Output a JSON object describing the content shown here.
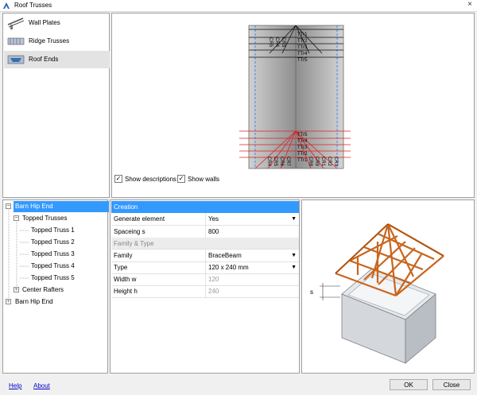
{
  "window": {
    "title": "Roof Trusses",
    "close_glyph": "×"
  },
  "nav": {
    "items": [
      {
        "label": "Wall Plates",
        "icon": "wall-plate-icon"
      },
      {
        "label": "Ridge Trusses",
        "icon": "ridge-truss-icon"
      },
      {
        "label": "Roof Ends",
        "icon": "roof-end-icon",
        "selected": true
      }
    ]
  },
  "preview": {
    "show_descriptions_label": "Show descriptions",
    "show_walls_label": "Show walls",
    "show_descriptions": true,
    "show_walls": true,
    "top_labels": [
      "TTr1",
      "TTr2",
      "TTr3",
      "TTr4",
      "TTr5"
    ],
    "bottom_labels": [
      "TTr5",
      "TTr4",
      "TTr3",
      "TTr2",
      "TTr1"
    ],
    "left_labels_top": [
      "CR5",
      "CR4",
      "CR3"
    ],
    "bottom_rafter_labels": [
      "CR4",
      "CR5",
      "CR6",
      "CR7",
      "CR8",
      "CR9",
      "CR1",
      "CR2",
      "CR3"
    ]
  },
  "tree": {
    "rows": [
      {
        "label": "Barn Hip End",
        "level": 0,
        "expander": "−",
        "selected": true
      },
      {
        "label": "Topped Trusses",
        "level": 1,
        "expander": "−"
      },
      {
        "label": "Topped Truss 1",
        "level": 2
      },
      {
        "label": "Topped Truss 2",
        "level": 2
      },
      {
        "label": "Topped Truss 3",
        "level": 2
      },
      {
        "label": "Topped Truss 4",
        "level": 2
      },
      {
        "label": "Topped Truss 5",
        "level": 2
      },
      {
        "label": "Center Rafters",
        "level": 1,
        "expander": "+"
      },
      {
        "label": "Barn Hip End",
        "level": 0,
        "expander": "+"
      }
    ]
  },
  "properties": {
    "header": "Creation",
    "rows_creation": [
      {
        "key": "Generate element",
        "value": "Yes",
        "dropdown": true
      },
      {
        "key": "Spaceing    s",
        "value": "800"
      }
    ],
    "category_family": "Family & Type",
    "rows_family": [
      {
        "key": "Family",
        "value": "BraceBeam",
        "dropdown": true
      },
      {
        "key": "Type",
        "value": "120 x 240 mm",
        "dropdown": true
      },
      {
        "key": "Width    w",
        "value": "120",
        "disabled": true
      },
      {
        "key": "Height    h",
        "value": "240",
        "disabled": true
      }
    ]
  },
  "illustration": {
    "dimension_label": "s"
  },
  "footer": {
    "help": "Help",
    "about": "About",
    "ok": "OK",
    "close": "Close"
  },
  "colors": {
    "selection": "#3399ff",
    "truss": "#c8661e",
    "guide": "#1e7bff",
    "red_line": "#e02020"
  }
}
